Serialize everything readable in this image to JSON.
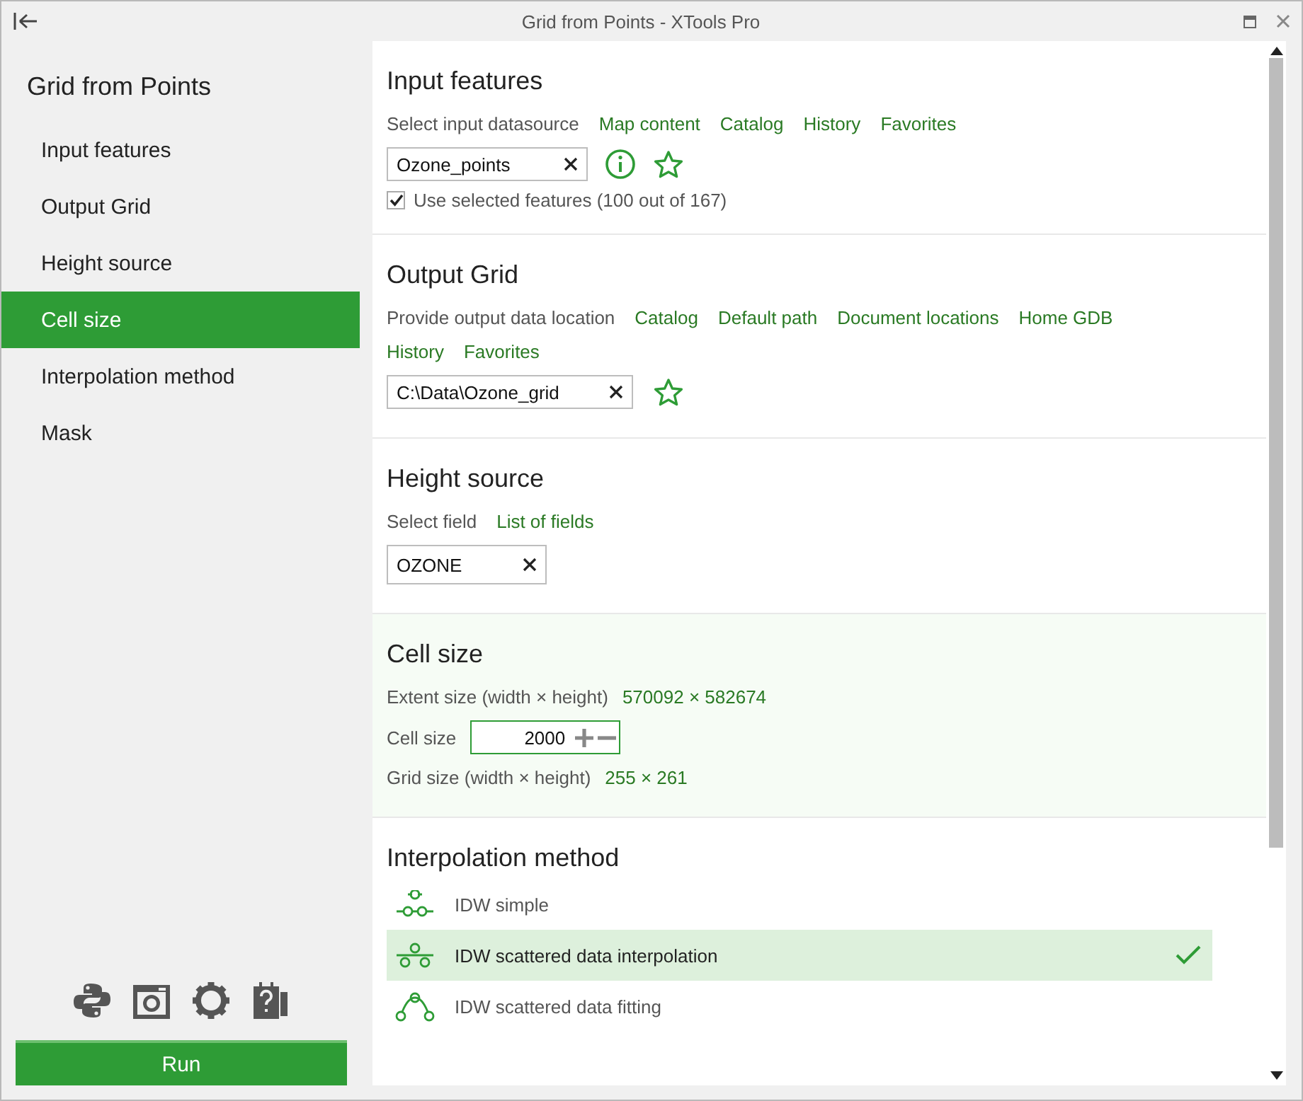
{
  "window": {
    "title": "Grid from Points - XTools Pro"
  },
  "sidebar": {
    "title": "Grid from Points",
    "items": [
      {
        "label": "Input features",
        "selected": false
      },
      {
        "label": "Output Grid",
        "selected": false
      },
      {
        "label": "Height source",
        "selected": false
      },
      {
        "label": "Cell size",
        "selected": true
      },
      {
        "label": "Interpolation method",
        "selected": false
      },
      {
        "label": "Mask",
        "selected": false
      }
    ],
    "run_button": "Run"
  },
  "input_features": {
    "title": "Input features",
    "link_rows": [
      [
        "Map content",
        "Catalog",
        "History",
        "Favorites"
      ]
    ],
    "prompt": "Select input datasource",
    "value": "Ozone_points",
    "use_selected": {
      "label": "Use selected features (100 out of 167)",
      "checked": true
    }
  },
  "output_grid": {
    "title": "Output Grid",
    "prompt": "Provide output data location",
    "link_rows": [
      [
        "Catalog",
        "Default path",
        "Document locations",
        "Home GDB"
      ],
      [
        "History",
        "Favorites"
      ]
    ],
    "value": "C:\\Data\\Ozone_grid"
  },
  "height_source": {
    "title": "Height source",
    "prompt": "Select field",
    "link_rows": [
      [
        "List of fields"
      ]
    ],
    "value": "OZONE"
  },
  "cell_size": {
    "title": "Cell size",
    "extent_label": "Extent size (width × height)",
    "extent_value": "570092 × 582674",
    "cell_label": "Cell size",
    "cell_value": "2000",
    "grid_label": "Grid size (width × height)",
    "grid_value": "255 × 261"
  },
  "interpolation": {
    "title": "Interpolation method",
    "methods": [
      {
        "label": "IDW simple",
        "selected": false
      },
      {
        "label": "IDW scattered data interpolation",
        "selected": true
      },
      {
        "label": "IDW scattered data fitting",
        "selected": false
      }
    ]
  }
}
